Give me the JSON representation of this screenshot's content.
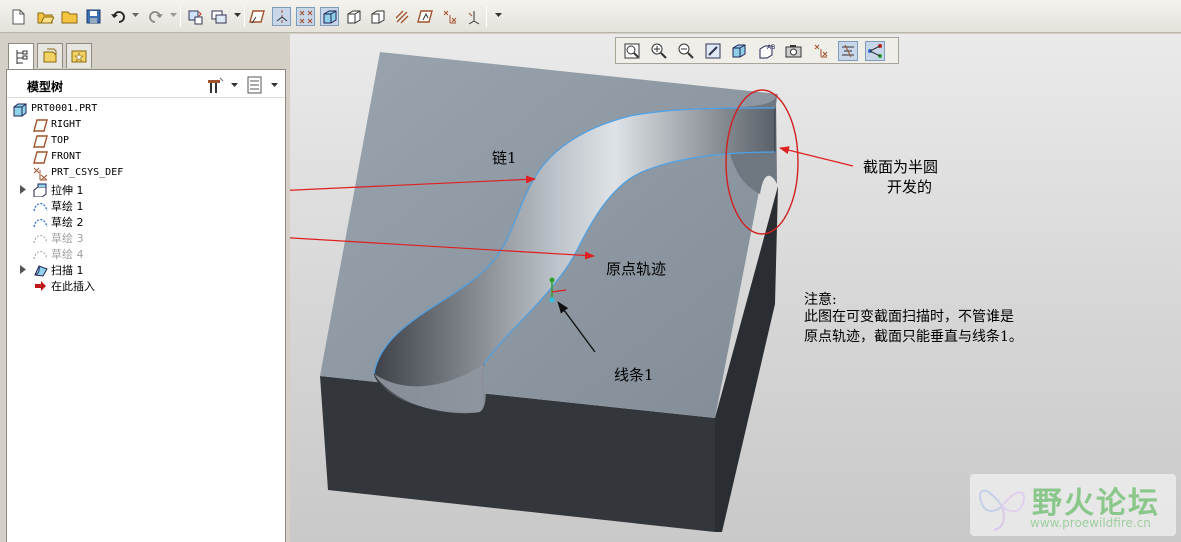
{
  "toolbar": {
    "icons": [
      "new-icon",
      "open-icon",
      "folder-icon",
      "save-icon",
      "undo-icon",
      "redo-icon",
      "regenerate-icon",
      "window-icon",
      "datum-plane-display-icon",
      "datum-axis-display-icon",
      "datum-point-display-icon",
      "shading-icon",
      "hidden-line-icon",
      "no-hidden-icon",
      "wireframe-icon",
      "sketch-icon",
      "csys-display-icon",
      "more-icon"
    ]
  },
  "panel": {
    "tabs": [
      "model-tree-tab",
      "layer-tab",
      "favorites-tab"
    ],
    "tree_title": "模型树",
    "items": [
      {
        "label": "PRT0001.PRT",
        "icon": "part-icon",
        "expandable": false,
        "dim": false
      },
      {
        "label": "RIGHT",
        "icon": "datum-plane-icon",
        "expandable": false,
        "dim": false
      },
      {
        "label": "TOP",
        "icon": "datum-plane-icon",
        "expandable": false,
        "dim": false
      },
      {
        "label": "FRONT",
        "icon": "datum-plane-icon",
        "expandable": false,
        "dim": false
      },
      {
        "label": "PRT_CSYS_DEF",
        "icon": "csys-icon",
        "expandable": false,
        "dim": false
      },
      {
        "label": "拉伸 1",
        "icon": "extrude-icon",
        "expandable": true,
        "dim": false
      },
      {
        "label": "草绘 1",
        "icon": "sketch-icon",
        "expandable": false,
        "dim": false
      },
      {
        "label": "草绘 2",
        "icon": "sketch-icon",
        "expandable": false,
        "dim": false
      },
      {
        "label": "草绘 3",
        "icon": "sketch-icon",
        "expandable": false,
        "dim": true
      },
      {
        "label": "草绘 4",
        "icon": "sketch-icon",
        "expandable": false,
        "dim": true
      },
      {
        "label": "扫描 1",
        "icon": "sweep-icon",
        "expandable": true,
        "dim": false
      },
      {
        "label": "在此插入",
        "icon": "insert-here-icon",
        "expandable": false,
        "dim": false
      }
    ]
  },
  "view_toolbar": {
    "icons": [
      "refit-icon",
      "zoom-in-icon",
      "zoom-out-icon",
      "repaint-icon",
      "orient-icon",
      "saved-views-icon",
      "display-style-icon",
      "datum-display-icon",
      "spin-center-icon",
      "annotation-display-icon"
    ]
  },
  "annotations": {
    "chain": "链1",
    "section": "截面为半圆",
    "section_line2": "开发的",
    "origin_traj": "原点轨迹",
    "line1": "线条1",
    "note_title": "注意:",
    "note_line1": "此图在可变截面扫描时，不管谁是",
    "note_line2": "原点轨迹，截面只能垂直与线条1。"
  },
  "colors": {
    "top_face": "#8e98a3",
    "side_face": "#33363a",
    "edge_highlight": "#4fa3e8",
    "arrow_red": "#e02020",
    "ellipse_red": "#d02020"
  },
  "watermark": {
    "title": "野火论坛",
    "url": "www.proewildfire.cn"
  }
}
